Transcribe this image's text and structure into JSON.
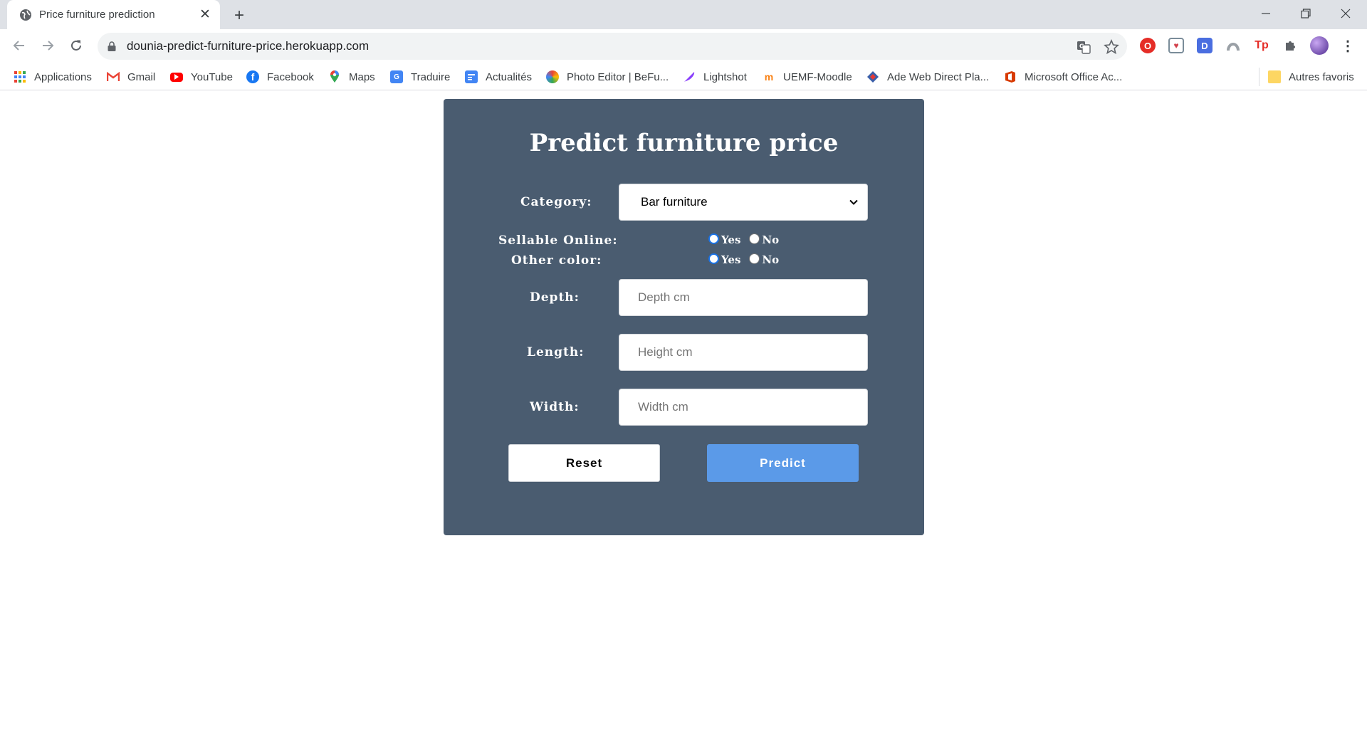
{
  "browser": {
    "tab_title": "Price furniture prediction",
    "url": "dounia-predict-furniture-price.herokuapp.com",
    "bookmarks": [
      {
        "label": "Applications",
        "icon": "apps-grid-icon"
      },
      {
        "label": "Gmail",
        "icon": "gmail-icon"
      },
      {
        "label": "YouTube",
        "icon": "youtube-icon"
      },
      {
        "label": "Facebook",
        "icon": "facebook-icon"
      },
      {
        "label": "Maps",
        "icon": "maps-pin-icon"
      },
      {
        "label": "Traduire",
        "icon": "translate-icon"
      },
      {
        "label": "Actualités",
        "icon": "news-icon"
      },
      {
        "label": "Photo Editor | BeFu...",
        "icon": "photo-editor-icon"
      },
      {
        "label": "Lightshot",
        "icon": "lightshot-feather-icon"
      },
      {
        "label": "UEMF-Moodle",
        "icon": "moodle-icon"
      },
      {
        "label": "Ade Web Direct Pla...",
        "icon": "ade-icon"
      },
      {
        "label": "Microsoft Office Ac...",
        "icon": "office-icon"
      }
    ],
    "other_bookmarks": "Autres favoris"
  },
  "page": {
    "title": "Predict furniture price",
    "category_label": "Category:",
    "category_value": "Bar furniture",
    "sellable_label": "Sellable Online:",
    "sellable_yes": "Yes",
    "sellable_no": "No",
    "sellable_selected": "Yes",
    "color_label": "Other color:",
    "color_yes": "Yes",
    "color_no": "No",
    "color_selected": "Yes",
    "depth_label": "Depth:",
    "depth_placeholder": "Depth cm",
    "length_label": "Length:",
    "length_placeholder": "Height cm",
    "width_label": "Width:",
    "width_placeholder": "Width cm",
    "reset_label": "Reset",
    "predict_label": "Predict"
  },
  "colors": {
    "card_background": "#4a5c70",
    "predict_button": "#5b9ae8",
    "radio_checked": "#1a73e8"
  }
}
